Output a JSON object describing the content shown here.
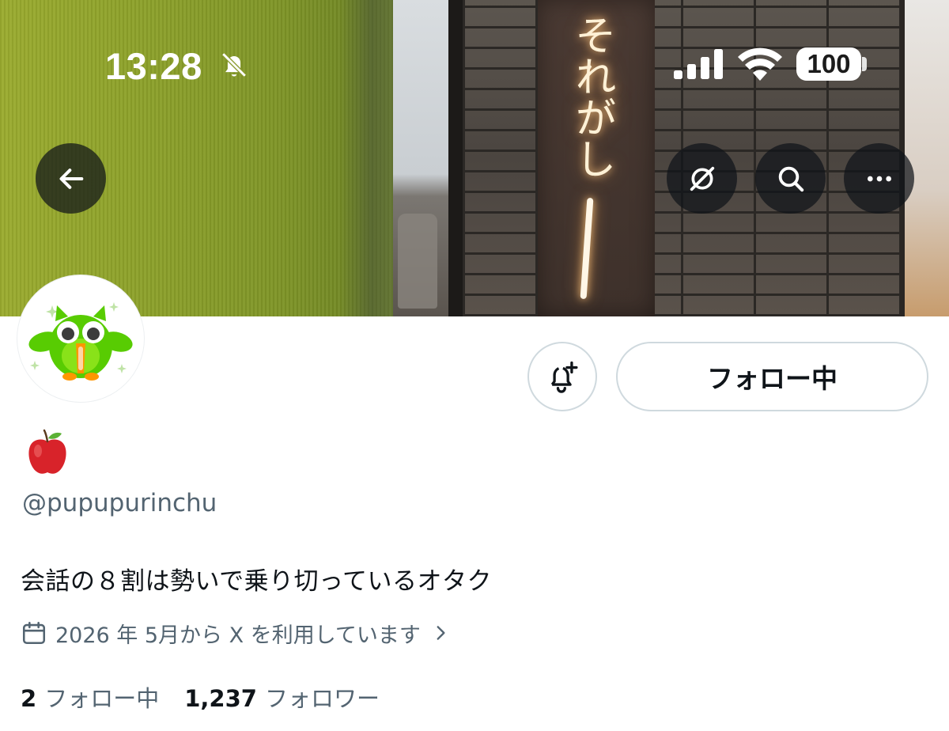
{
  "status_bar": {
    "time": "13:28",
    "battery": "100",
    "icons": [
      "bell-slash-icon",
      "cellular-signal-icon",
      "wifi-icon",
      "battery-icon"
    ]
  },
  "header": {
    "back_icon": "arrow-left-icon",
    "grok_icon": "grok-icon",
    "search_icon": "search-icon",
    "more_icon": "more-horizontal-icon"
  },
  "banner": {
    "sign_text": "それがし"
  },
  "profile": {
    "display_name_emoji": "🍎",
    "handle": "@pupupurinchu",
    "bio": "会話の８割は勢いで乗り切っているオタク",
    "joined": "2026 年 5月から X を利用しています",
    "following_count": "2",
    "following_label": "フォロー中",
    "followers_count": "1,237",
    "followers_label": "フォロワー"
  },
  "actions": {
    "notify_icon": "bell-plus-icon",
    "follow_label": "フォロー中"
  },
  "colors": {
    "text_primary": "#0f1419",
    "text_secondary": "#536471",
    "button_border": "#cfd9de",
    "overlay_button": "#0f1419"
  }
}
